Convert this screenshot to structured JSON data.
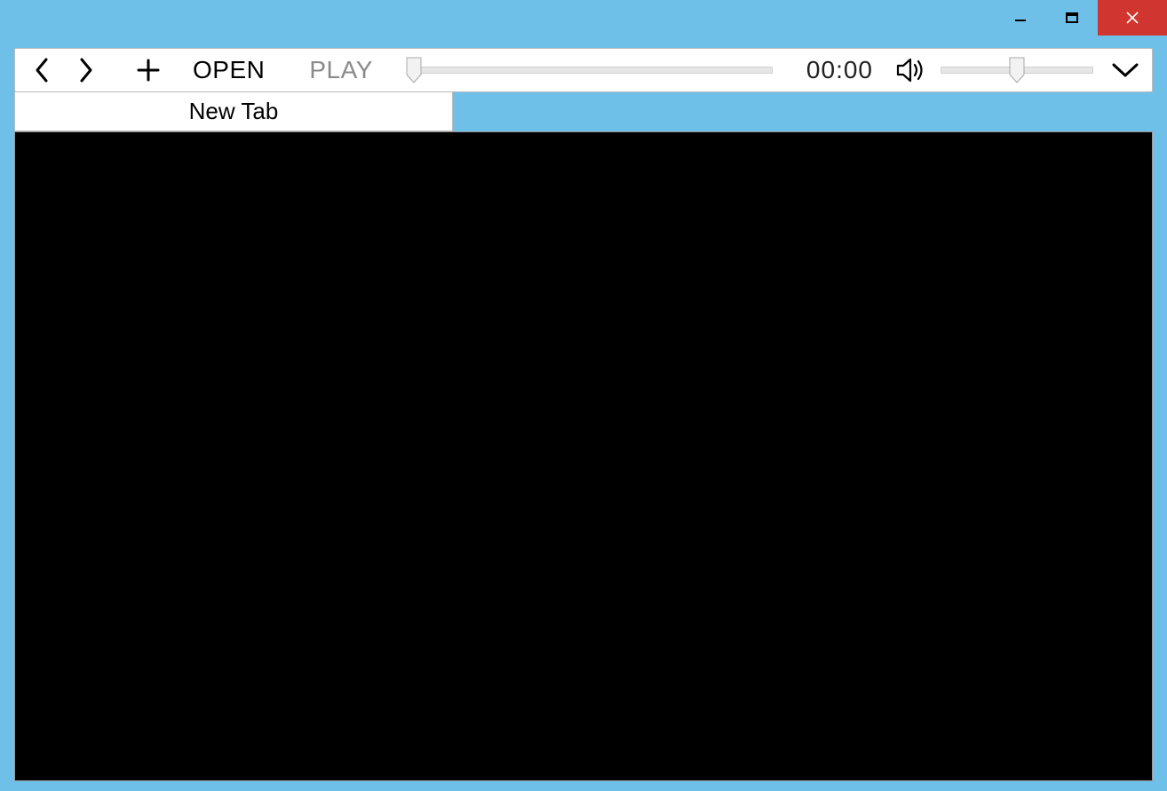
{
  "toolbar": {
    "open_label": "OPEN",
    "play_label": "PLAY",
    "time_display": "00:00",
    "progress_value_percent": 2,
    "volume_value_percent": 50
  },
  "tabs": [
    {
      "label": "New Tab"
    }
  ],
  "colors": {
    "window_bg": "#6fc0e8",
    "close_btn": "#d0362f",
    "content_bg": "#000000"
  }
}
